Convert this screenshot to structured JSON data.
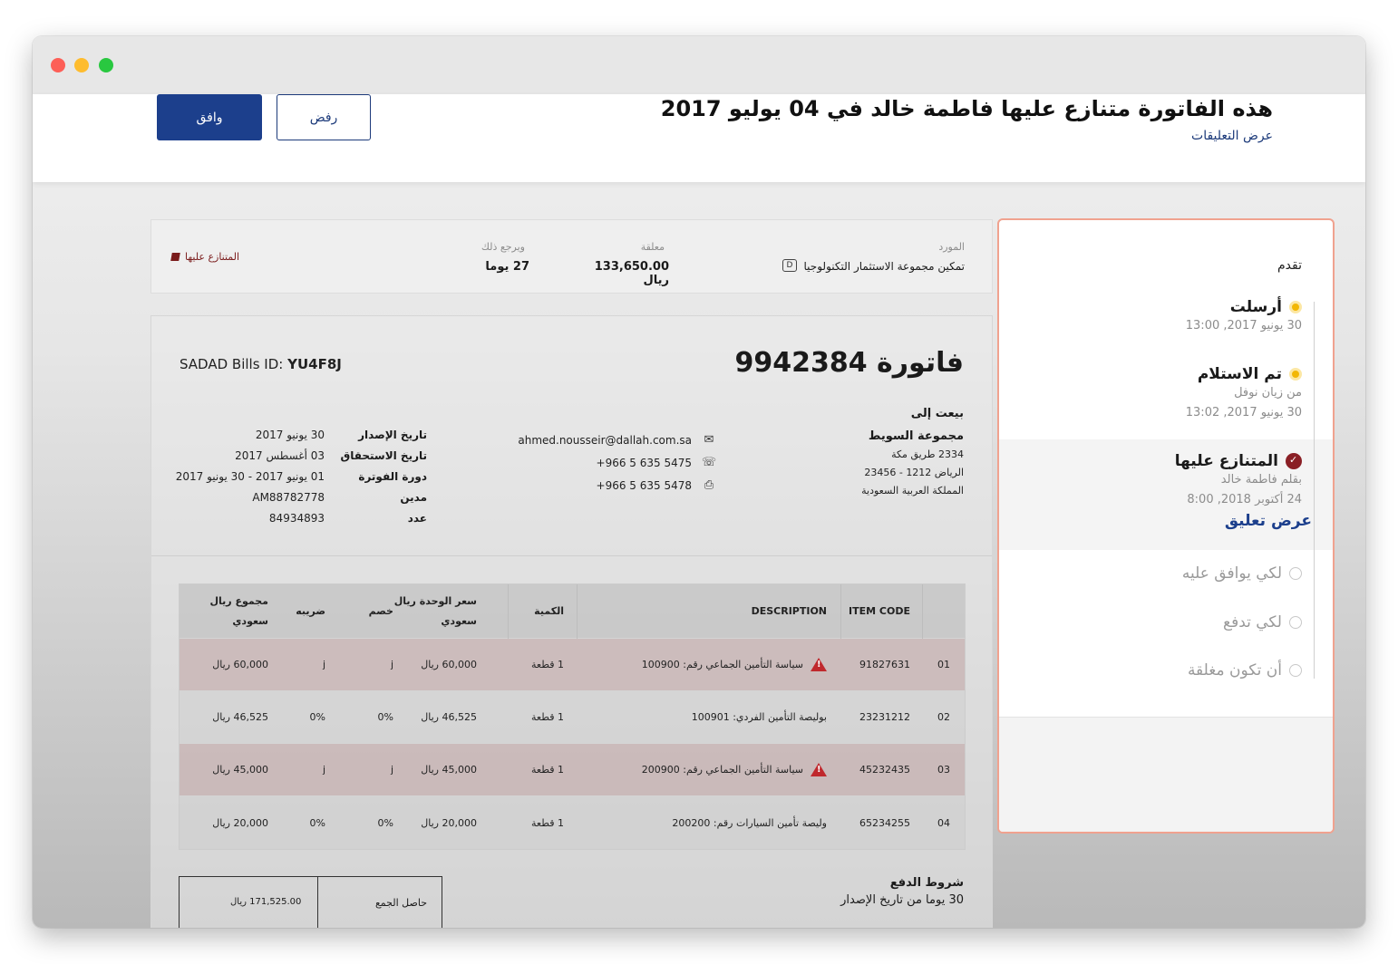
{
  "header": {
    "title": "هذه الفاتورة متنازع عليها فاطمة خالد في 04 يوليو 2017",
    "view_comments": "عرض التعليقات",
    "approve_label": "وافق",
    "reject_label": "رفض"
  },
  "summary": {
    "supplier_label": "المورد",
    "supplier_value": "تمكين مجموعة الاستثمار التكنولوجيا",
    "outstanding_label": "معلقة",
    "outstanding_value": "133,650.00",
    "outstanding_currency": "ريال",
    "due_label": "ويرجع ذلك",
    "due_value": "27 يوما",
    "status": "المتنازع عليها"
  },
  "invoice": {
    "title": "فاتورة 9942384",
    "sadad_label": "SADAD Bills ID:",
    "sadad_value": "YU4F8J",
    "sold_to_heading": "بيعت إلى",
    "sold_to_name": "مجموعة السويط",
    "address_line1": "2334 طريق مكة",
    "address_line2": "الرياض 1212 - 23456",
    "address_line3": "المملكة العربية السعودية",
    "email": "ahmed.nousseir@dallah.com.sa",
    "phone": "+966 5 635 5475",
    "fax": "+966 5 635 5478",
    "meta": [
      {
        "key": "تاريخ الإصدار",
        "value": "30 يونيو 2017"
      },
      {
        "key": "تاريخ الاستحقاق",
        "value": "03 أغسطس 2017"
      },
      {
        "key": "دورة الفوترة",
        "value": "01 يونيو 2017 - 30 يونيو 2017"
      },
      {
        "key": "مدين",
        "value": "AM88782778"
      },
      {
        "key": "عدد",
        "value": "84934893"
      }
    ],
    "columns": {
      "item_code": "ITEM CODE",
      "description": "DESCRIPTION",
      "quantity": "الكمية",
      "unit_price": "سعر الوحدة ريال سعودي",
      "discount": "خصم",
      "tax": "ضريبه",
      "total": "مجموع ريال سعودي"
    },
    "rows": [
      {
        "no": "01",
        "code": "91827631",
        "desc": "سياسة التأمين الجماعي رقم: 100900",
        "qty": "1 قطعة",
        "unit": "60,000 ريال",
        "disc": "j",
        "tax": "j",
        "total": "60,000 ريال"
      },
      {
        "no": "02",
        "code": "23231212",
        "desc": "بوليصة التأمين الفردي: 100901",
        "qty": "1 قطعة",
        "unit": "46,525 ريال",
        "disc": "0%",
        "tax": "0%",
        "total": "46,525 ريال"
      },
      {
        "no": "03",
        "code": "45232435",
        "desc": "سياسة التأمين الجماعي رقم: 200900",
        "qty": "1 قطعة",
        "unit": "45,000 ريال",
        "disc": "j",
        "tax": "j",
        "total": "45,000 ريال"
      },
      {
        "no": "04",
        "code": "65234255",
        "desc": "وليصة تأمين السيارات رقم: 200200",
        "qty": "1 قطعة",
        "unit": "20,000 ريال",
        "disc": "0%",
        "tax": "0%",
        "total": "20,000 ريال"
      }
    ],
    "subtotal_label": "حاصل الجمع",
    "subtotal_value": "171,525.00 ريال",
    "terms_heading": "شروط الدفع",
    "terms_value": "30 يوما من تاريخ الإصدار"
  },
  "progress": {
    "title": "تقدم",
    "steps": [
      {
        "label": "أرسلت",
        "sub1": "30 يونيو 2017, 13:00",
        "state": "done"
      },
      {
        "label": "تم الاستلام",
        "sub1": "من زيان نوفل",
        "sub2": "30 يونيو 2017, 13:02",
        "state": "done"
      },
      {
        "label": "المتنازع عليها",
        "sub1": "بقلم فاطمة خالد",
        "sub2": "24 أكتوبر 2018, 8:00",
        "link": "عرض تعليق",
        "state": "disputed"
      },
      {
        "label": "لكي يوافق عليه",
        "state": "pending"
      },
      {
        "label": "لكي تدفع",
        "state": "pending"
      },
      {
        "label": "أن تكون مغلقة",
        "state": "pending"
      }
    ]
  },
  "colors": {
    "primary": "#1c3f8c",
    "dispute": "#8a1f25",
    "warning": "#c0282d",
    "step_done": "#f2b705",
    "panel_border": "#f0a28f"
  }
}
